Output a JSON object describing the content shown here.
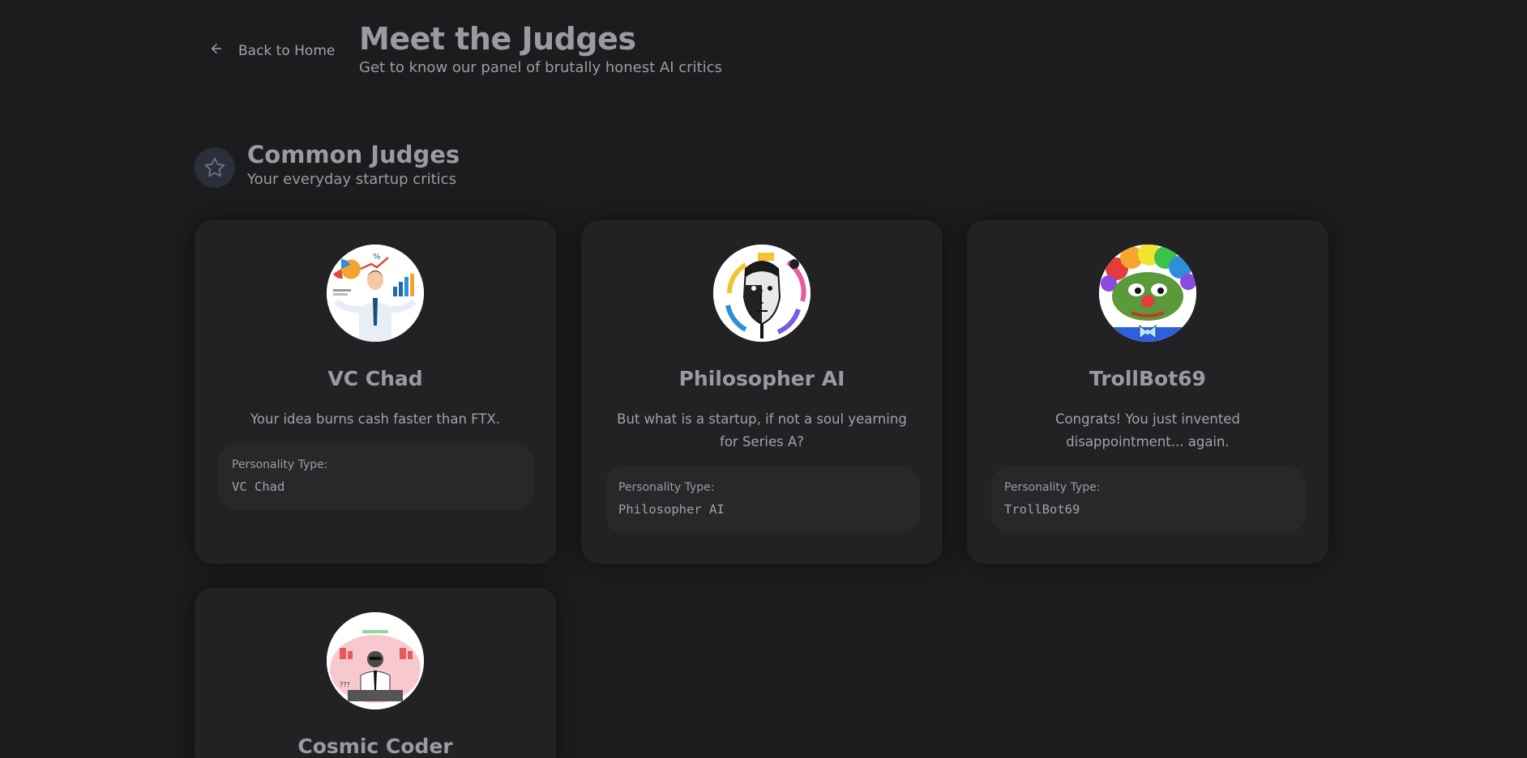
{
  "nav": {
    "back_label": "Back to Home"
  },
  "header": {
    "title": "Meet the Judges",
    "subtitle": "Get to know our panel of brutally honest AI critics"
  },
  "section": {
    "title": "Common Judges",
    "subtitle": "Your everyday startup critics",
    "icon": "star-icon"
  },
  "judges": [
    {
      "name": "VC Chad",
      "quote": "Your idea burns cash faster than FTX.",
      "personality_label": "Personality Type:",
      "personality_value": "VC Chad"
    },
    {
      "name": "Philosopher AI",
      "quote": "But what is a startup, if not a soul yearning for Series A?",
      "personality_label": "Personality Type:",
      "personality_value": "Philosopher AI"
    },
    {
      "name": "TrollBot69",
      "quote": "Congrats! You just invented disappointment... again.",
      "personality_label": "Personality Type:",
      "personality_value": "TrollBot69"
    },
    {
      "name": "Cosmic Coder"
    }
  ],
  "colors": {
    "background": "#1c1c1e",
    "card": "#222225",
    "text": "#a1a1aa"
  }
}
